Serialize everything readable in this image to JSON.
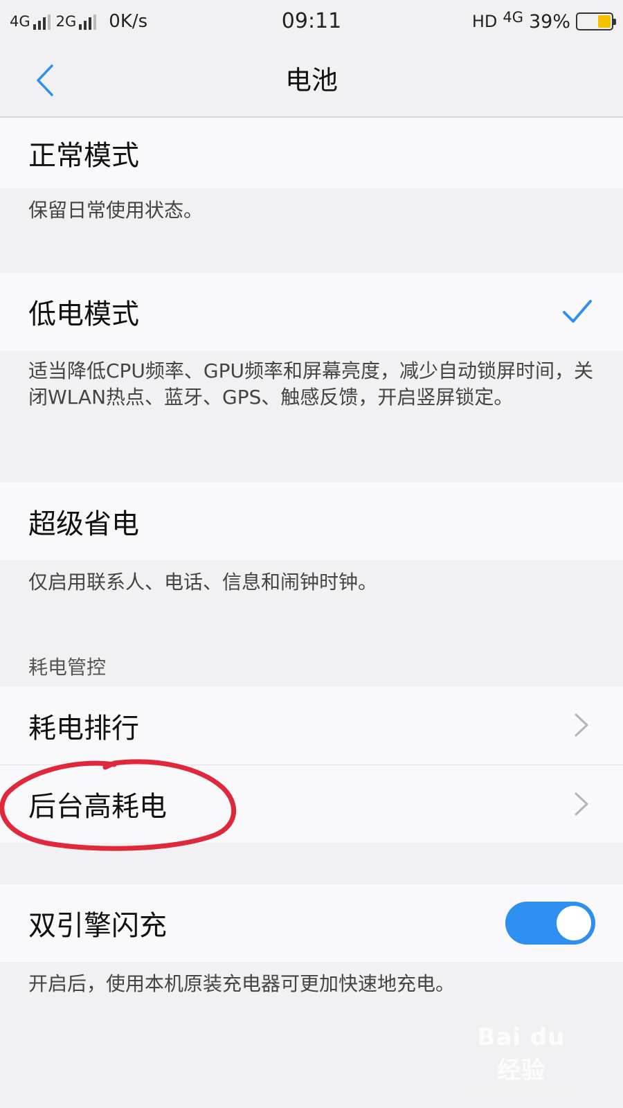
{
  "status_bar": {
    "network1": "4G",
    "network2": "2G",
    "speed": "0K/s",
    "time": "09:11",
    "hd": "HD",
    "volte": "4G",
    "battery_percent": "39%",
    "battery_level": 0.39
  },
  "nav": {
    "title": "电池"
  },
  "modes": [
    {
      "label": "正常模式",
      "description": "保留日常使用状态。",
      "selected": false
    },
    {
      "label": "低电模式",
      "description": "适当降低CPU频率、GPU频率和屏幕亮度，减少自动锁屏时间，关闭WLAN热点、蓝牙、GPS、触感反馈，开启竖屏锁定。",
      "selected": true
    },
    {
      "label": "超级省电",
      "description": "仅启用联系人、电话、信息和闹钟时钟。",
      "selected": false
    }
  ],
  "power_control": {
    "header": "耗电管控",
    "items": [
      {
        "label": "耗电排行"
      },
      {
        "label": "后台高耗电"
      }
    ]
  },
  "dual_engine": {
    "label": "双引擎闪充",
    "enabled": true,
    "description": "开启后，使用本机原装充电器可更加快速地充电。"
  },
  "watermark": {
    "logo": "Bai du 经验",
    "url": "jingyan.baidu.com"
  },
  "colors": {
    "accent": "#2f8ff0",
    "annotation": "#e0283c",
    "battery_fill": "#f5c000"
  }
}
